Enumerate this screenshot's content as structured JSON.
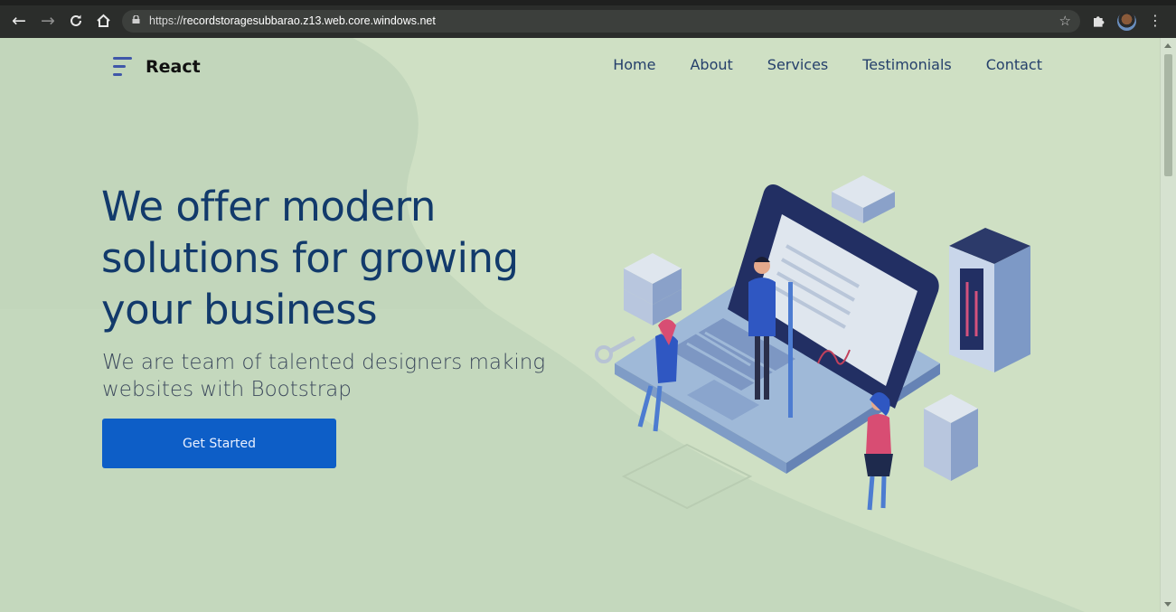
{
  "browser": {
    "url_scheme": "https://",
    "url_host": "recordstoragesubbarao.z13.web.core.windows.net",
    "back_icon": "arrow-left-icon",
    "forward_icon": "arrow-right-icon",
    "reload_icon": "reload-icon",
    "home_icon": "home-icon"
  },
  "header": {
    "brand": "React",
    "nav": [
      "Home",
      "About",
      "Services",
      "Testimonials",
      "Contact"
    ]
  },
  "hero": {
    "title": "We offer modern solutions for growing your business",
    "subtitle": "We are team of talented designers making websites with Bootstrap",
    "cta_label": "Get Started"
  },
  "colors": {
    "page_bg": "#cfe0c4",
    "title": "#123a6b",
    "cta_bg": "#0d5ec7",
    "brand_icon": "#3f57a9"
  }
}
